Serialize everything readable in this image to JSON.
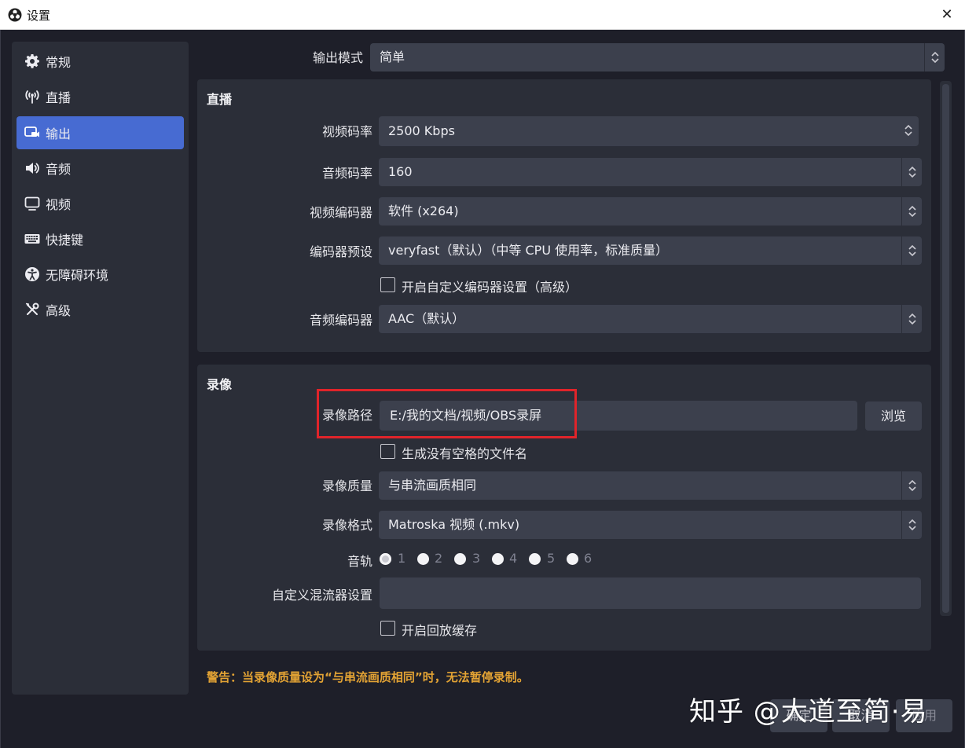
{
  "window": {
    "title": "设置",
    "close_glyph": "✕"
  },
  "sidebar": {
    "items": [
      {
        "label": "常规",
        "icon": "gear-icon"
      },
      {
        "label": "直播",
        "icon": "antenna-icon"
      },
      {
        "label": "输出",
        "icon": "output-icon",
        "active": true
      },
      {
        "label": "音频",
        "icon": "speaker-icon"
      },
      {
        "label": "视频",
        "icon": "monitor-icon"
      },
      {
        "label": "快捷键",
        "icon": "keyboard-icon"
      },
      {
        "label": "无障碍环境",
        "icon": "accessibility-icon"
      },
      {
        "label": "高级",
        "icon": "tools-icon"
      }
    ]
  },
  "output_mode": {
    "label": "输出模式",
    "value": "简单"
  },
  "streaming": {
    "title": "直播",
    "video_bitrate": {
      "label": "视频码率",
      "value": "2500 Kbps"
    },
    "audio_bitrate": {
      "label": "音频码率",
      "value": "160"
    },
    "video_encoder": {
      "label": "视频编码器",
      "value": "软件 (x264)"
    },
    "encoder_preset": {
      "label": "编码器预设",
      "value": "veryfast（默认）（中等 CPU 使用率，标准质量）"
    },
    "custom_encoder_checkbox": {
      "label": "开启自定义编码器设置（高级）",
      "checked": false
    },
    "audio_encoder": {
      "label": "音频编码器",
      "value": "AAC（默认）"
    }
  },
  "recording": {
    "title": "录像",
    "path": {
      "label": "录像路径",
      "value": "E:/我的文档/视频/OBS录屏"
    },
    "browse_label": "浏览",
    "no_space_checkbox": {
      "label": "生成没有空格的文件名",
      "checked": false
    },
    "quality": {
      "label": "录像质量",
      "value": "与串流画质相同"
    },
    "format": {
      "label": "录像格式",
      "value": "Matroska 视频 (.mkv)"
    },
    "tracks": {
      "label": "音轨",
      "options": [
        "1",
        "2",
        "3",
        "4",
        "5",
        "6"
      ],
      "selected": "1"
    },
    "custom_muxer": {
      "label": "自定义混流器设置",
      "value": ""
    },
    "replay_buffer_checkbox": {
      "label": "开启回放缓存",
      "checked": false
    }
  },
  "warning": "警告：当录像质量设为“与串流画质相同”时，无法暂停录制。",
  "footer": {
    "ok_label": "确定",
    "cancel_label": "取消",
    "apply_label": "应用"
  },
  "watermark": "知乎 @大道至简·易",
  "colors": {
    "accent": "#476bd2",
    "warning": "#e3a334",
    "highlight": "#e0242a",
    "panel": "#2b2e38",
    "background": "#1e1f29"
  }
}
